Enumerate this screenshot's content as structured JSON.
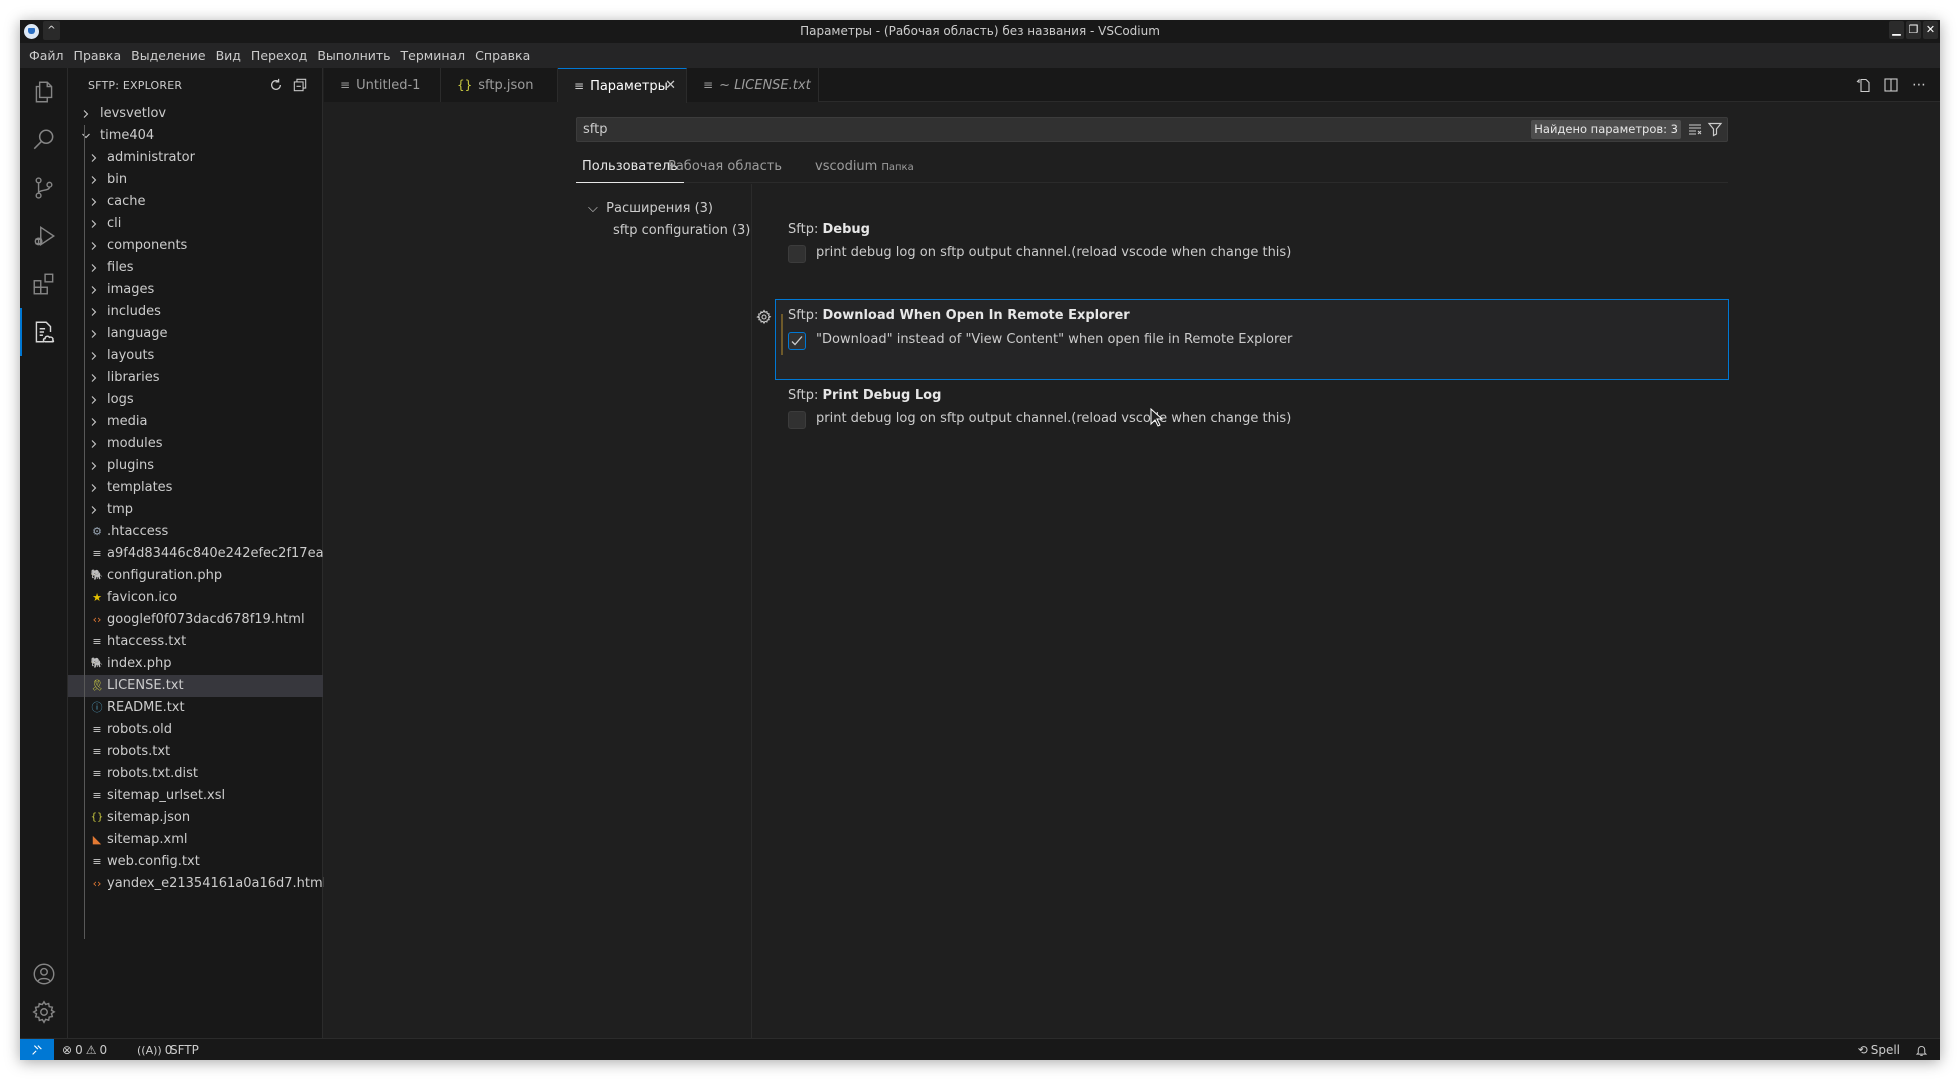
{
  "window": {
    "title": "Параметры - (Рабочая область) без названия - VSCodium",
    "controls": {
      "minimize": "▁",
      "restore": "❐",
      "close": "✕"
    }
  },
  "menu": [
    "Файл",
    "Правка",
    "Выделение",
    "Вид",
    "Переход",
    "Выполнить",
    "Терминал",
    "Справка"
  ],
  "activity_bar": {
    "items": [
      "explorer",
      "search",
      "source-control",
      "run-and-debug",
      "extensions",
      "sftp-remote-explorer"
    ],
    "bottom": [
      "accounts",
      "manage"
    ],
    "active": "sftp-remote-explorer"
  },
  "sidebar": {
    "title": "SFTP: EXPLORER",
    "roots": [
      {
        "label": "levsvetlov",
        "expanded": false
      },
      {
        "label": "time404",
        "expanded": true
      }
    ],
    "folders": [
      "administrator",
      "bin",
      "cache",
      "cli",
      "components",
      "files",
      "images",
      "includes",
      "language",
      "layouts",
      "libraries",
      "logs",
      "media",
      "modules",
      "plugins",
      "templates",
      "tmp"
    ],
    "files": [
      {
        "label": ".htaccess",
        "icon": "gear",
        "color": "#9aa7b5"
      },
      {
        "label": "a9f4d83446c840e242efec2f17ea...",
        "icon": "text",
        "color": "#cccccc"
      },
      {
        "label": "configuration.php",
        "icon": "php",
        "color": "#a074c4"
      },
      {
        "label": "favicon.ico",
        "icon": "star",
        "color": "#e5c100"
      },
      {
        "label": "googlef0f073dacd678f19.html",
        "icon": "html",
        "color": "#e37933"
      },
      {
        "label": "htaccess.txt",
        "icon": "text",
        "color": "#cccccc"
      },
      {
        "label": "index.php",
        "icon": "php",
        "color": "#a074c4"
      },
      {
        "label": "LICENSE.txt",
        "icon": "license",
        "color": "#cbcb41",
        "selected": true
      },
      {
        "label": "README.txt",
        "icon": "info",
        "color": "#519aba"
      },
      {
        "label": "robots.old",
        "icon": "text",
        "color": "#cccccc"
      },
      {
        "label": "robots.txt",
        "icon": "text",
        "color": "#cccccc"
      },
      {
        "label": "robots.txt.dist",
        "icon": "text",
        "color": "#cccccc"
      },
      {
        "label": "sitemap_urlset.xsl",
        "icon": "text",
        "color": "#cccccc"
      },
      {
        "label": "sitemap.json",
        "icon": "json",
        "color": "#cbcb41"
      },
      {
        "label": "sitemap.xml",
        "icon": "rss",
        "color": "#e37933"
      },
      {
        "label": "web.config.txt",
        "icon": "text",
        "color": "#cccccc"
      },
      {
        "label": "yandex_e21354161a0a16d7.html",
        "icon": "html",
        "color": "#e37933"
      }
    ]
  },
  "tabs": [
    {
      "label": "Untitled-1",
      "icon": "≡",
      "active": false
    },
    {
      "label": "sftp.json",
      "icon": "{}",
      "active": false
    },
    {
      "label": "Параметры",
      "icon": "≡",
      "active": true,
      "close": "✕"
    },
    {
      "label": "~ LICENSE.txt",
      "icon": "≡",
      "active": false,
      "italic": true
    }
  ],
  "settings": {
    "search_value": "sftp",
    "results_count": "Найдено параметров: 3",
    "scope_tabs": [
      {
        "label": "Пользователь",
        "active": true
      },
      {
        "label": "Рабочая область",
        "active": false
      },
      {
        "label": "vscodium",
        "hint": "Папка",
        "active": false
      }
    ],
    "toc": [
      {
        "label": "Расширения (3)",
        "expanded": true
      },
      {
        "label": "sftp configuration (3)"
      }
    ],
    "items": [
      {
        "category": "Sftp: ",
        "name": "Debug",
        "checked": false,
        "description": "print debug log on sftp output channel.(reload vscode when change this)"
      },
      {
        "category": "Sftp: ",
        "name": "Download When Open In Remote Explorer",
        "checked": true,
        "modified": true,
        "focused": true,
        "description": "\"Download\" instead of \"View Content\" when open file in Remote Explorer"
      },
      {
        "category": "Sftp: ",
        "name": "Print Debug Log",
        "checked": false,
        "description": "print debug log on sftp output channel.(reload vscode when change this)"
      }
    ]
  },
  "status_bar": {
    "errors": "0",
    "warnings": "0",
    "ports": "0",
    "sftp": "SFTP",
    "spell": "Spell"
  }
}
